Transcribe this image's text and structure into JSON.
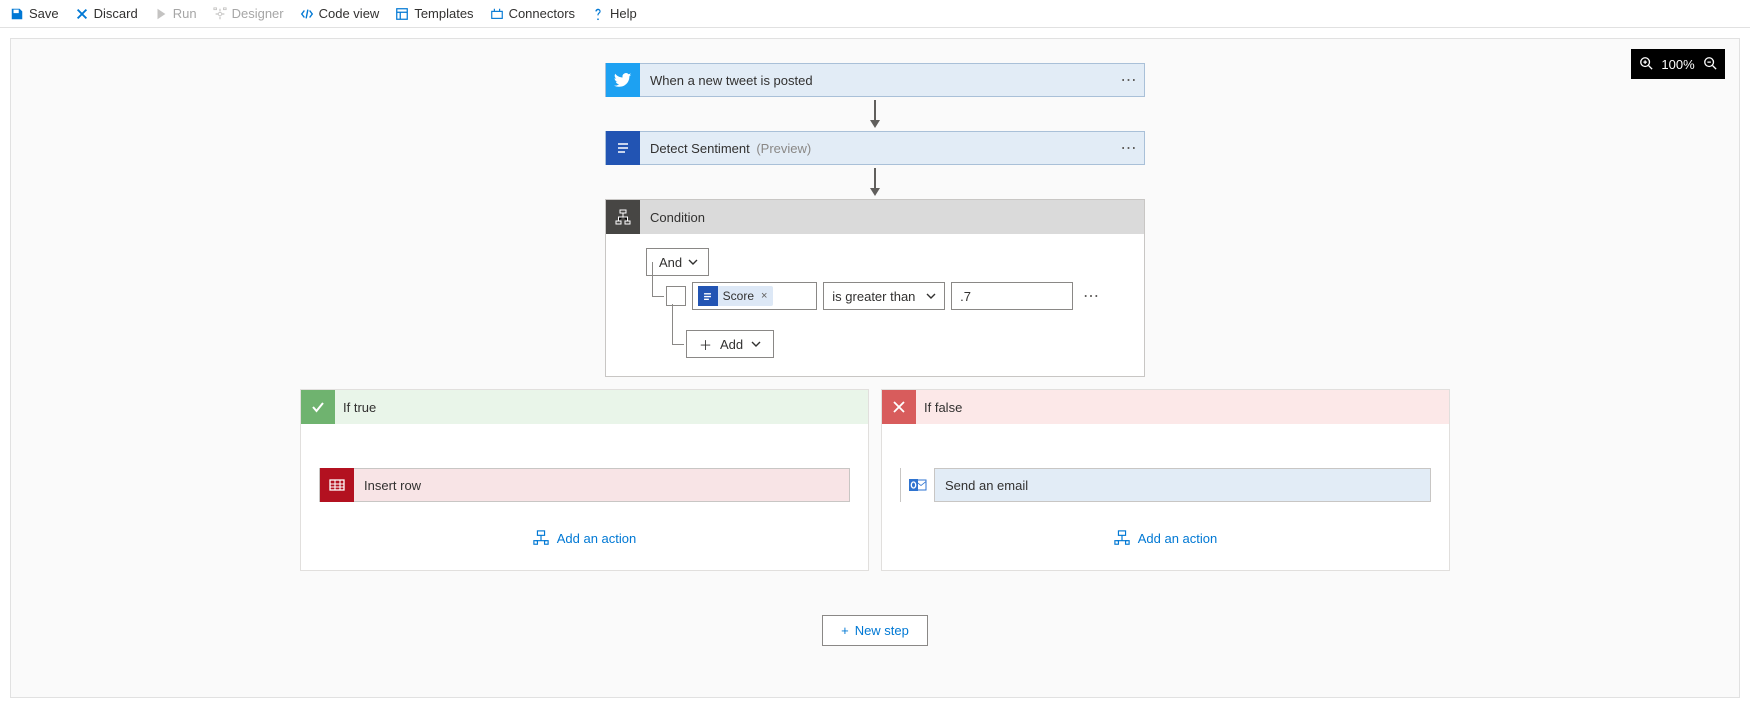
{
  "toolbar": {
    "save": "Save",
    "discard": "Discard",
    "run": "Run",
    "designer": "Designer",
    "codeview": "Code view",
    "templates": "Templates",
    "connectors": "Connectors",
    "help": "Help"
  },
  "zoom": {
    "level": "100%"
  },
  "flow": {
    "trigger": {
      "label": "When a new tweet is posted"
    },
    "sentiment": {
      "label": "Detect Sentiment",
      "preview": "(Preview)"
    },
    "condition": {
      "title": "Condition",
      "groupOp": "And",
      "token": "Score",
      "operator": "is greater than",
      "value": ".7",
      "addLabel": "Add"
    },
    "trueBranch": {
      "title": "If true",
      "action": "Insert row",
      "addAction": "Add an action"
    },
    "falseBranch": {
      "title": "If false",
      "action": "Send an email",
      "addAction": "Add an action"
    },
    "newStep": "New step"
  }
}
